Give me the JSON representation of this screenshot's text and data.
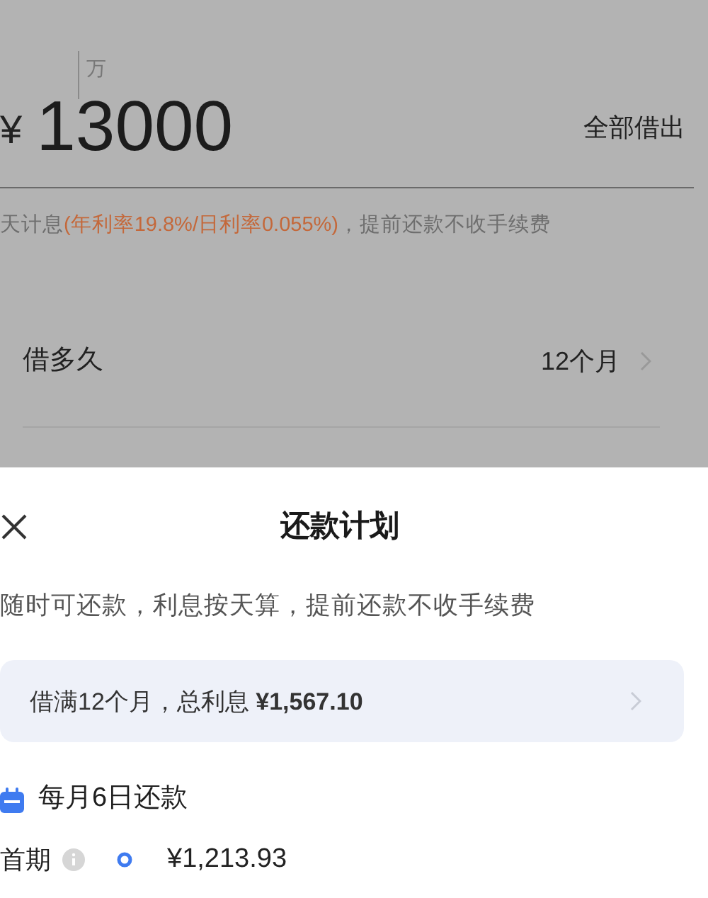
{
  "amount": {
    "unit_hint": "万",
    "currency": "¥",
    "value": "13000",
    "action": "全部借出"
  },
  "rate_note": [
    {
      "text": "天计息",
      "kind": "plain"
    },
    {
      "text": "(年利率19.8%/日利率0.055%)",
      "kind": "highlight"
    },
    {
      "text": "，提前还款不收手续费",
      "kind": "plain"
    }
  ],
  "term": {
    "label": "借多久",
    "value": "12个月"
  },
  "sheet": {
    "title": "还款计划",
    "subtitle": "随时可还款，利息按天算，提前还款不收手续费",
    "summary": "借满12个月，总利息 **¥1,567.10**",
    "schedule_title": "每月6日还款",
    "first": {
      "label": "首期",
      "amount": "¥1,213.93"
    }
  }
}
